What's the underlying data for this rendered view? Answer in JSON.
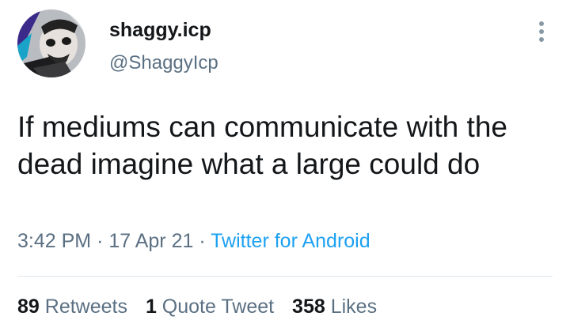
{
  "author": {
    "display_name": "shaggy.icp",
    "handle": "@ShaggyIcp",
    "avatar_icon": "profile-photo-avatar"
  },
  "tweet": {
    "text": "If mediums can communicate with the dead imagine what a large could do",
    "time": "3:42 PM",
    "separator": "·",
    "date": "17 Apr 21",
    "source": "Twitter for Android"
  },
  "stats": {
    "retweets_count": "89",
    "retweets_label": "Retweets",
    "quotes_count": "1",
    "quotes_label": "Quote Tweet",
    "likes_count": "358",
    "likes_label": "Likes"
  },
  "colors": {
    "text": "#14171a",
    "secondary": "#5b7083",
    "link": "#1da1f2",
    "divider": "#e1e8ed"
  },
  "icons": {
    "more": "more-vertical-icon"
  }
}
